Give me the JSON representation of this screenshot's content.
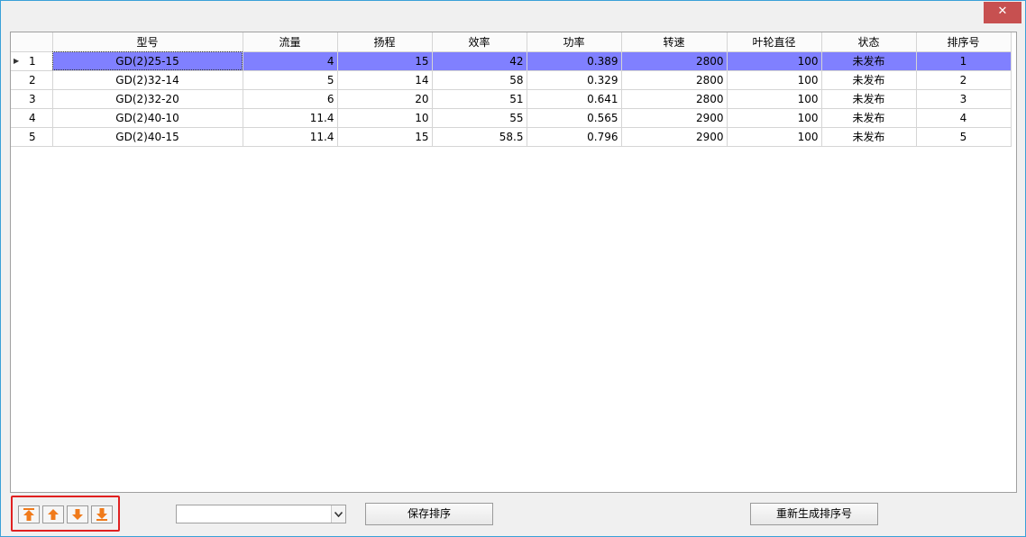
{
  "window": {
    "close_glyph": "✕"
  },
  "grid": {
    "columns": [
      "型号",
      "流量",
      "扬程",
      "效率",
      "功率",
      "转速",
      "叶轮直径",
      "状态",
      "排序号"
    ],
    "rows": [
      {
        "index": "1",
        "cells": [
          "GD(2)25-15",
          "4",
          "15",
          "42",
          "0.389",
          "2800",
          "100",
          "未发布",
          "1"
        ]
      },
      {
        "index": "2",
        "cells": [
          "GD(2)32-14",
          "5",
          "14",
          "58",
          "0.329",
          "2800",
          "100",
          "未发布",
          "2"
        ]
      },
      {
        "index": "3",
        "cells": [
          "GD(2)32-20",
          "6",
          "20",
          "51",
          "0.641",
          "2800",
          "100",
          "未发布",
          "3"
        ]
      },
      {
        "index": "4",
        "cells": [
          "GD(2)40-10",
          "11.4",
          "10",
          "55",
          "0.565",
          "2900",
          "100",
          "未发布",
          "4"
        ]
      },
      {
        "index": "5",
        "cells": [
          "GD(2)40-15",
          "11.4",
          "15",
          "58.5",
          "0.796",
          "2900",
          "100",
          "未发布",
          "5"
        ]
      }
    ],
    "selected_row": 0,
    "selection_color": "#8080ff"
  },
  "toolbar": {
    "move_buttons": [
      "move-to-top-icon",
      "move-up-icon",
      "move-down-icon",
      "move-to-bottom-icon"
    ],
    "move_icon_color": "#f07a1a",
    "combo_value": "",
    "save_sort_label": "保存排序",
    "regenerate_label": "重新生成排序号"
  }
}
